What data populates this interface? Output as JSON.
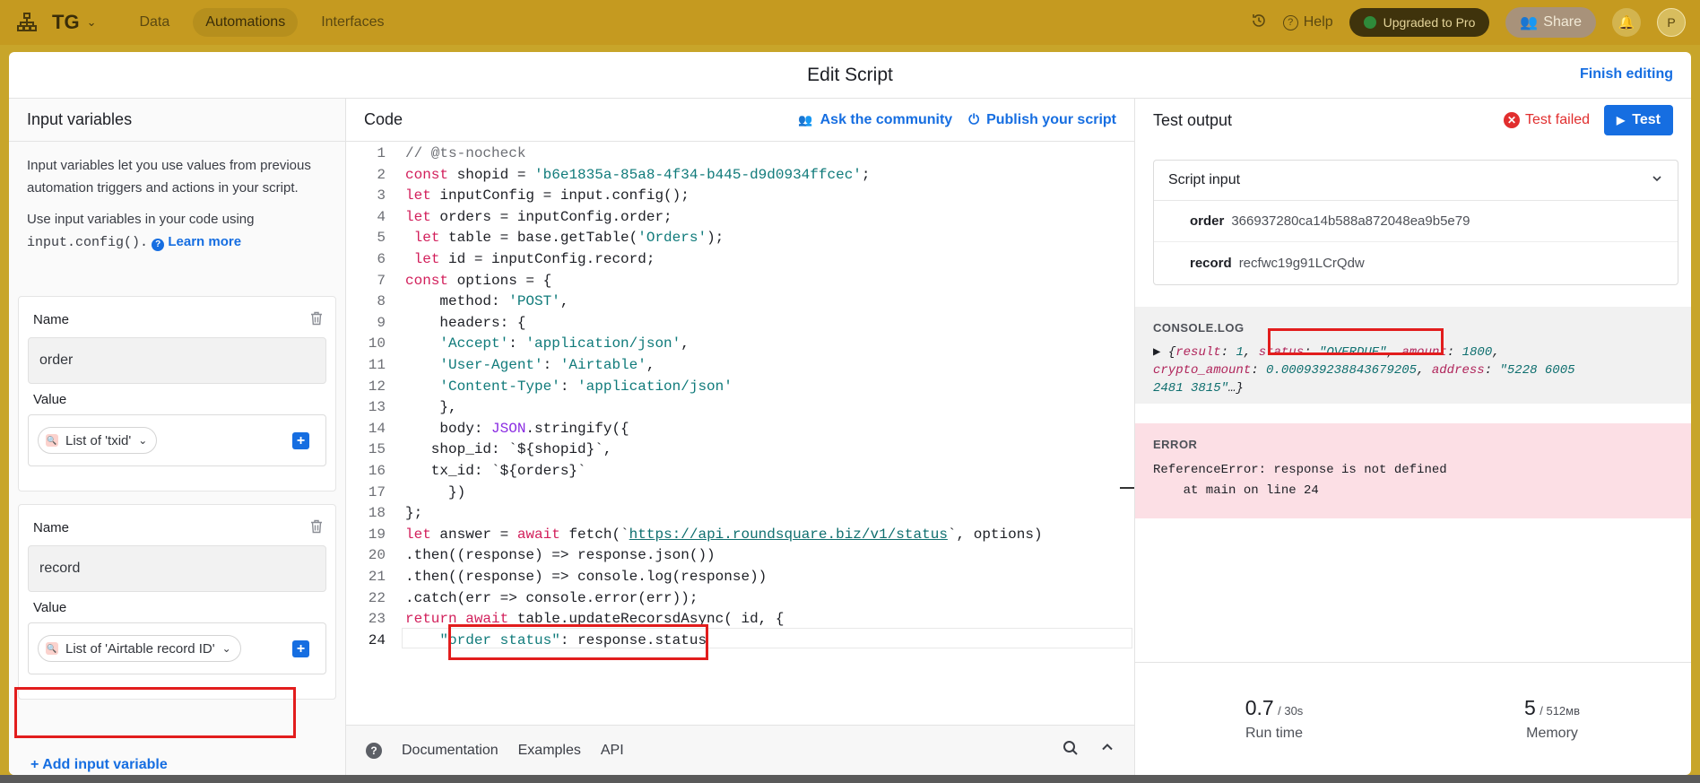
{
  "topbar": {
    "base_name": "TG",
    "tabs": [
      "Data",
      "Automations",
      "Interfaces"
    ],
    "help": "Help",
    "upgraded": "Upgraded to Pro",
    "share": "Share",
    "avatar_initial": "P"
  },
  "modal": {
    "title": "Edit Script",
    "finish": "Finish editing"
  },
  "left": {
    "title": "Input variables",
    "help1": "Input variables let you use values from previous automation triggers and actions in your script.",
    "help2_prefix": "Use input variables in your code using",
    "help2_code": "input.config().",
    "learn_more": "Learn more",
    "name_label": "Name",
    "value_label": "Value",
    "variables": [
      {
        "name": "order",
        "value": "List of 'txid'"
      },
      {
        "name": "record",
        "value": "List of 'Airtable record ID'"
      }
    ],
    "add_variable": "+ Add input variable"
  },
  "code": {
    "title": "Code",
    "ask_community": "Ask the community",
    "publish": "Publish your script",
    "active_line": 24,
    "footer": {
      "documentation": "Documentation",
      "examples": "Examples",
      "api": "API"
    }
  },
  "right": {
    "title": "Test output",
    "test_failed": "Test failed",
    "test_button": "Test",
    "script_input": {
      "title": "Script input",
      "rows": [
        {
          "key": "order",
          "value": "366937280ca14b588a872048ea9b5e79"
        },
        {
          "key": "record",
          "value": "recfwc19g91LCrQdw"
        }
      ]
    },
    "console_label": "CONSOLE.LOG",
    "error_label": "ERROR",
    "error_line1": "ReferenceError: response is not defined",
    "error_line2": "    at main on line 24",
    "stats": {
      "runtime_value": "0.7",
      "runtime_max": "/ 30s",
      "runtime_label": "Run time",
      "memory_value": "5",
      "memory_max": "/ 512мв",
      "memory_label": "Memory"
    }
  }
}
